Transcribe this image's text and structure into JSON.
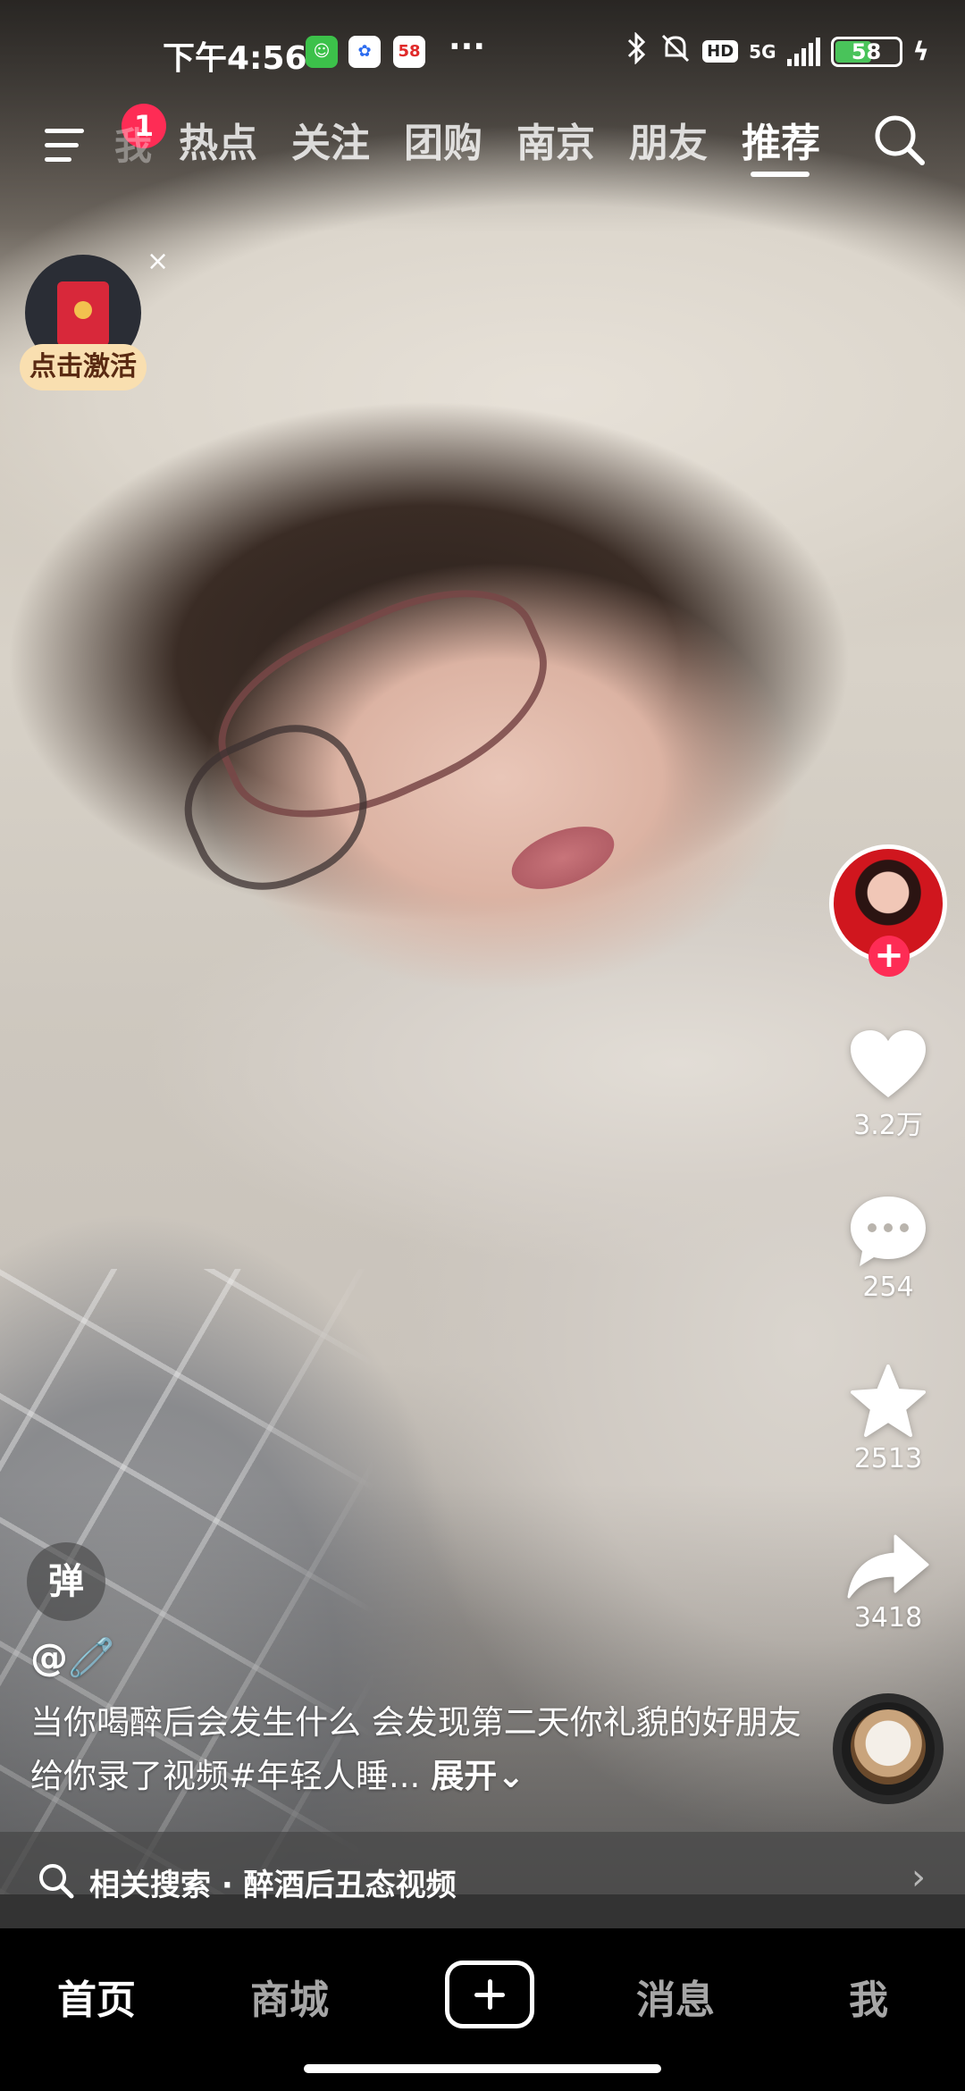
{
  "status_bar": {
    "time": "下午4:56",
    "app_icon_c_text": "58",
    "more_dots": "···",
    "hd_label": "HD",
    "network": "5G",
    "battery": "58"
  },
  "top_nav": {
    "menu_badge": "1",
    "faded_tab": "我",
    "tabs": [
      {
        "label": "热点"
      },
      {
        "label": "关注"
      },
      {
        "label": "团购"
      },
      {
        "label": "南京"
      },
      {
        "label": "朋友"
      },
      {
        "label": "推荐"
      }
    ],
    "active_tab": "推荐"
  },
  "red_packet": {
    "close_glyph": "×",
    "label": "点击激活"
  },
  "actions": {
    "likes": "3.2万",
    "comments": "254",
    "favorites": "2513",
    "shares": "3418",
    "follow_glyph": "+"
  },
  "video": {
    "danmaku_glyph": "弹",
    "author": "@🧷",
    "caption": "当你喝醉后会发生什么 会发现第二天你礼貌的好朋友给你录了视频#年轻人睡...",
    "expand_label": "展开⌄"
  },
  "related_search": {
    "label": "相关搜索 · 醉酒后丑态视频",
    "chevron": "›"
  },
  "bottom_nav": {
    "home": "首页",
    "mall": "商城",
    "messages": "消息",
    "me": "我"
  },
  "colors": {
    "accent": "#fe2c55",
    "red_packet_label_bg": "#f9dfb0",
    "battery_fill": "#49c35a"
  }
}
